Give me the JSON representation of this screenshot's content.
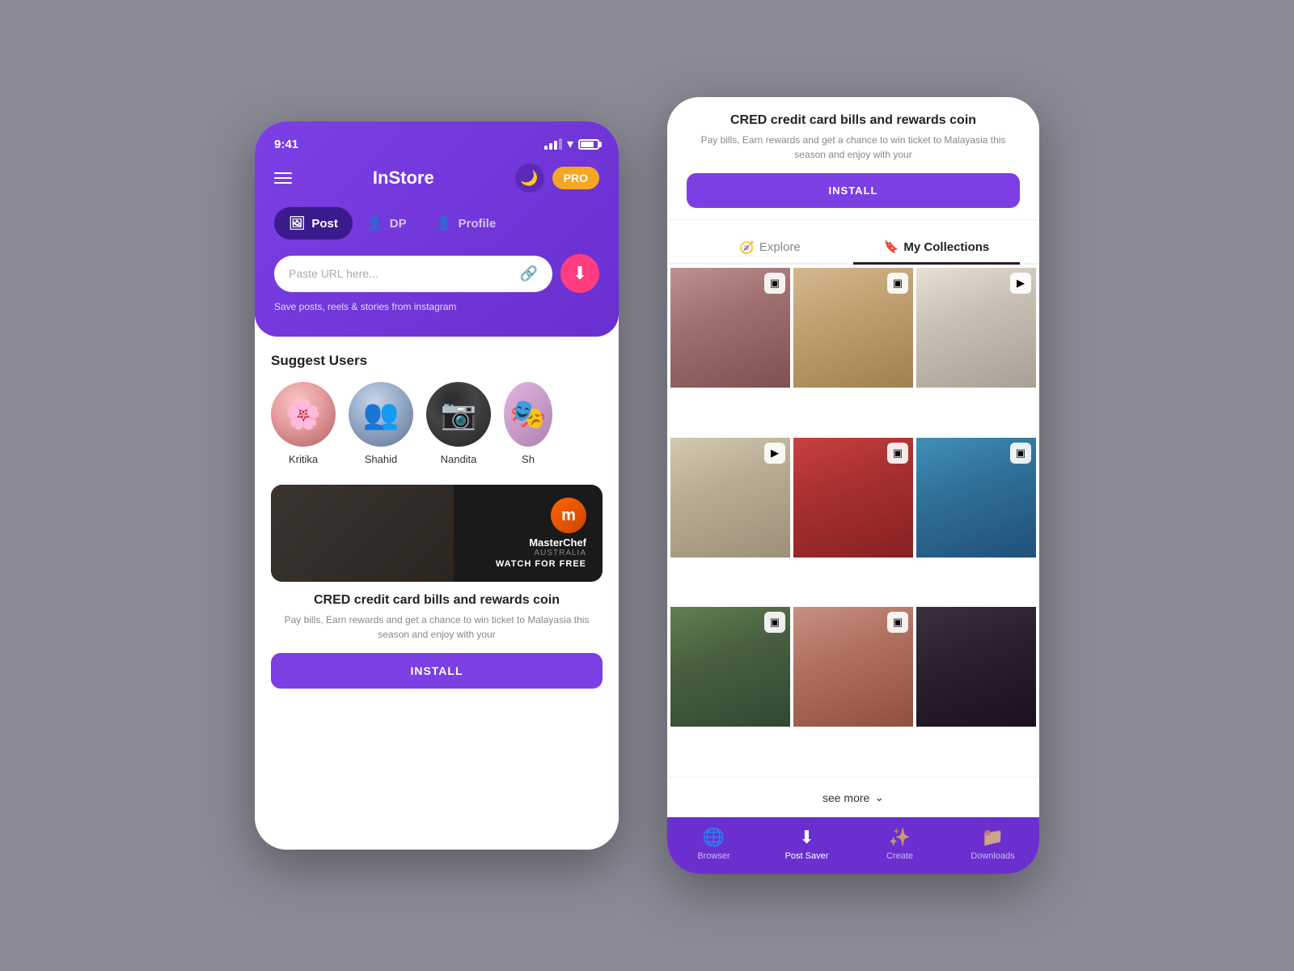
{
  "leftPhone": {
    "statusBar": {
      "time": "9:41"
    },
    "appName": "InStore",
    "proLabel": "PRO",
    "tabs": [
      {
        "id": "post",
        "label": "Post",
        "active": true
      },
      {
        "id": "dp",
        "label": "DP",
        "active": false
      },
      {
        "id": "profile",
        "label": "Profile",
        "active": false
      }
    ],
    "urlInput": {
      "placeholder": "Paste URL here...",
      "value": ""
    },
    "hint": "Save posts, reels & stories from instagram",
    "suggestTitle": "Suggest Users",
    "users": [
      {
        "id": "kritika",
        "name": "Kritika",
        "colorClass": "avatar-kritika"
      },
      {
        "id": "shahid",
        "name": "Shahid",
        "colorClass": "avatar-shahid"
      },
      {
        "id": "nandita",
        "name": "Nandita",
        "colorClass": "avatar-nandita"
      },
      {
        "id": "partial",
        "name": "Sh",
        "colorClass": "avatar-partial"
      }
    ],
    "banner": {
      "brandName": "MasterChef",
      "subTitle": "AUSTRALIA",
      "watchLabel": "WATCH FOR FREE"
    },
    "ad": {
      "title": "CRED credit card bills and rewards coin",
      "desc": "Pay bills, Earn rewards and get a chance to win ticket to Malayasia this season and enjoy with your",
      "installLabel": "INSTALL"
    }
  },
  "rightPhone": {
    "ad": {
      "title": "CRED credit card bills and rewards coin",
      "desc": "Pay bills, Earn rewards and get a chance to win ticket to Malayasia this season and enjoy with your",
      "installLabel": "INSTALL"
    },
    "tabs": [
      {
        "id": "explore",
        "label": "Explore",
        "active": false
      },
      {
        "id": "my-collections",
        "label": "My Collections",
        "active": true
      }
    ],
    "gridItems": [
      {
        "id": 1,
        "colorClass": "gc1",
        "badgeType": "square",
        "badgeIcon": "▣"
      },
      {
        "id": 2,
        "colorClass": "gc2",
        "badgeType": "square",
        "badgeIcon": "▣"
      },
      {
        "id": 3,
        "colorClass": "gc3",
        "badgeType": "play",
        "badgeIcon": "▶"
      },
      {
        "id": 4,
        "colorClass": "gc4",
        "badgeType": "play",
        "badgeIcon": "▶"
      },
      {
        "id": 5,
        "colorClass": "gc5",
        "badgeType": "square",
        "badgeIcon": "▣"
      },
      {
        "id": 6,
        "colorClass": "gc6",
        "badgeType": "square",
        "badgeIcon": "▣"
      },
      {
        "id": 7,
        "colorClass": "gc7",
        "badgeType": "square",
        "badgeIcon": "▣"
      },
      {
        "id": 8,
        "colorClass": "gc8",
        "badgeType": "square",
        "badgeIcon": "▣"
      },
      {
        "id": 9,
        "colorClass": "gc9",
        "badgeType": "none",
        "badgeIcon": ""
      }
    ],
    "seeMore": "see more",
    "bottomNav": [
      {
        "id": "browser",
        "label": "Browser",
        "icon": "🌐",
        "active": false
      },
      {
        "id": "post-saver",
        "label": "Post Saver",
        "icon": "⬇",
        "active": true
      },
      {
        "id": "create",
        "label": "Create",
        "icon": "✨",
        "active": false
      },
      {
        "id": "downloads",
        "label": "Downloads",
        "icon": "📁",
        "active": false
      }
    ]
  }
}
